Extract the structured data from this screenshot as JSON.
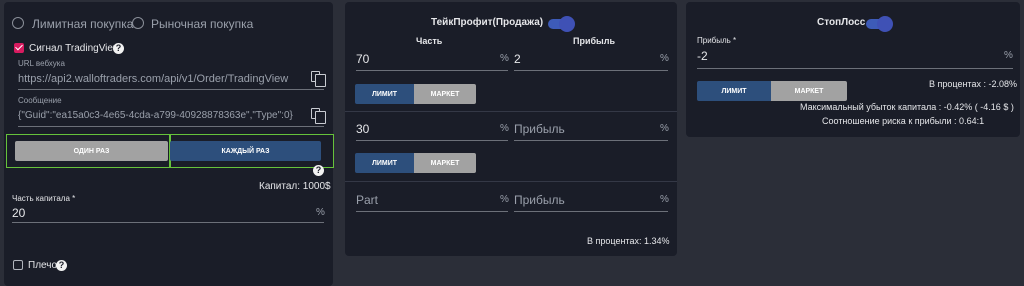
{
  "left": {
    "order_type": {
      "limit_label": "Лимитная покупка",
      "market_label": "Рыночная покупка"
    },
    "signal": {
      "label": "Сигнал TradingView",
      "help": "?"
    },
    "webhook": {
      "label": "URL вебхука",
      "value": "https://api2.walloftraders.com/api/v1/Order/TradingView"
    },
    "message": {
      "label": "Сообщение",
      "value": "{\"Guid\":\"ea15a0c3-4e65-4cda-a799-40928878363e\",\"Type\":0}"
    },
    "frequency": {
      "once_label": "ОДИН РАЗ",
      "each_label": "КАЖДЫЙ РАЗ",
      "help": "?"
    },
    "capital_text": "Капитал: 1000$",
    "capital_part": {
      "label": "Часть капитала *",
      "value": "20",
      "unit": "%"
    },
    "leverage": {
      "label": "Плечо",
      "help": "?"
    }
  },
  "tp": {
    "title": "ТейкПрофит(Продажа)",
    "col_part": "Часть",
    "col_profit": "Прибыль",
    "rows": [
      {
        "part": "70",
        "part_unit": "%",
        "profit": "2",
        "profit_unit": "%"
      },
      {
        "part": "30",
        "part_unit": "%",
        "profit": "Прибыль",
        "profit_unit": "%"
      },
      {
        "part": "Part",
        "part_unit": "%",
        "profit": "Прибыль",
        "profit_unit": "%"
      }
    ],
    "seg": {
      "limit": "ЛИМИТ",
      "market": "МАРКЕТ"
    },
    "percent_text": "В процентах: 1.34%"
  },
  "sl": {
    "title": "СтопЛосс",
    "profit_label": "Прибыль *",
    "profit_value": "-2",
    "profit_unit": "%",
    "percent_text": "В процентах : -2.08%",
    "seg": {
      "limit": "ЛИМИТ",
      "market": "МАРКЕТ"
    },
    "max_loss": "Максимальный убыток капитала : -0.42% ( -4.16 $ )",
    "risk_ratio": "Соотношение риска к прибыли : 0.64:1"
  },
  "colors": {
    "accent": "#3f51b5",
    "checkbox": "#d81b60",
    "outline": "#66c23b",
    "segment_active": "#2d4f7c"
  }
}
